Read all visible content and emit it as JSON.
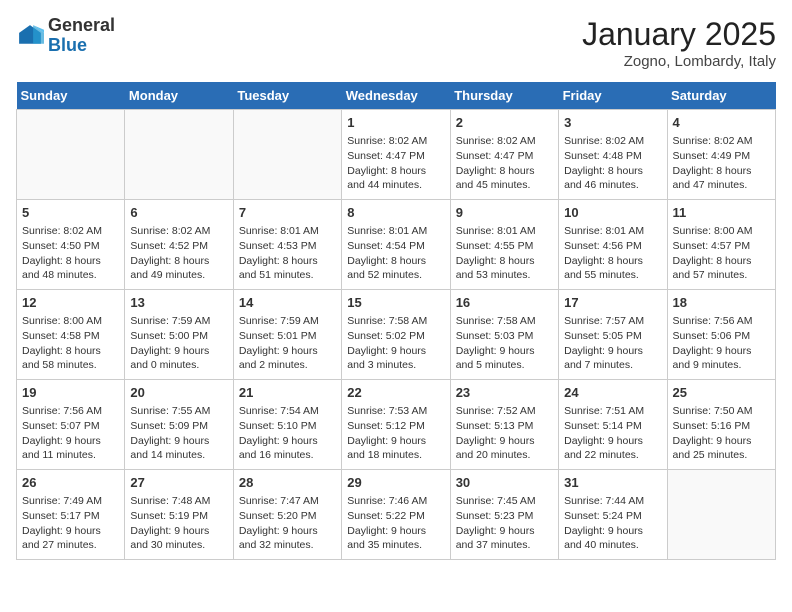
{
  "header": {
    "logo_general": "General",
    "logo_blue": "Blue",
    "month_title": "January 2025",
    "location": "Zogno, Lombardy, Italy"
  },
  "days_of_week": [
    "Sunday",
    "Monday",
    "Tuesday",
    "Wednesday",
    "Thursday",
    "Friday",
    "Saturday"
  ],
  "weeks": [
    [
      {
        "day": "",
        "empty": true
      },
      {
        "day": "",
        "empty": true
      },
      {
        "day": "",
        "empty": true
      },
      {
        "day": "1",
        "sunrise": "Sunrise: 8:02 AM",
        "sunset": "Sunset: 4:47 PM",
        "daylight": "Daylight: 8 hours and 44 minutes."
      },
      {
        "day": "2",
        "sunrise": "Sunrise: 8:02 AM",
        "sunset": "Sunset: 4:47 PM",
        "daylight": "Daylight: 8 hours and 45 minutes."
      },
      {
        "day": "3",
        "sunrise": "Sunrise: 8:02 AM",
        "sunset": "Sunset: 4:48 PM",
        "daylight": "Daylight: 8 hours and 46 minutes."
      },
      {
        "day": "4",
        "sunrise": "Sunrise: 8:02 AM",
        "sunset": "Sunset: 4:49 PM",
        "daylight": "Daylight: 8 hours and 47 minutes."
      }
    ],
    [
      {
        "day": "5",
        "sunrise": "Sunrise: 8:02 AM",
        "sunset": "Sunset: 4:50 PM",
        "daylight": "Daylight: 8 hours and 48 minutes."
      },
      {
        "day": "6",
        "sunrise": "Sunrise: 8:02 AM",
        "sunset": "Sunset: 4:52 PM",
        "daylight": "Daylight: 8 hours and 49 minutes."
      },
      {
        "day": "7",
        "sunrise": "Sunrise: 8:01 AM",
        "sunset": "Sunset: 4:53 PM",
        "daylight": "Daylight: 8 hours and 51 minutes."
      },
      {
        "day": "8",
        "sunrise": "Sunrise: 8:01 AM",
        "sunset": "Sunset: 4:54 PM",
        "daylight": "Daylight: 8 hours and 52 minutes."
      },
      {
        "day": "9",
        "sunrise": "Sunrise: 8:01 AM",
        "sunset": "Sunset: 4:55 PM",
        "daylight": "Daylight: 8 hours and 53 minutes."
      },
      {
        "day": "10",
        "sunrise": "Sunrise: 8:01 AM",
        "sunset": "Sunset: 4:56 PM",
        "daylight": "Daylight: 8 hours and 55 minutes."
      },
      {
        "day": "11",
        "sunrise": "Sunrise: 8:00 AM",
        "sunset": "Sunset: 4:57 PM",
        "daylight": "Daylight: 8 hours and 57 minutes."
      }
    ],
    [
      {
        "day": "12",
        "sunrise": "Sunrise: 8:00 AM",
        "sunset": "Sunset: 4:58 PM",
        "daylight": "Daylight: 8 hours and 58 minutes."
      },
      {
        "day": "13",
        "sunrise": "Sunrise: 7:59 AM",
        "sunset": "Sunset: 5:00 PM",
        "daylight": "Daylight: 9 hours and 0 minutes."
      },
      {
        "day": "14",
        "sunrise": "Sunrise: 7:59 AM",
        "sunset": "Sunset: 5:01 PM",
        "daylight": "Daylight: 9 hours and 2 minutes."
      },
      {
        "day": "15",
        "sunrise": "Sunrise: 7:58 AM",
        "sunset": "Sunset: 5:02 PM",
        "daylight": "Daylight: 9 hours and 3 minutes."
      },
      {
        "day": "16",
        "sunrise": "Sunrise: 7:58 AM",
        "sunset": "Sunset: 5:03 PM",
        "daylight": "Daylight: 9 hours and 5 minutes."
      },
      {
        "day": "17",
        "sunrise": "Sunrise: 7:57 AM",
        "sunset": "Sunset: 5:05 PM",
        "daylight": "Daylight: 9 hours and 7 minutes."
      },
      {
        "day": "18",
        "sunrise": "Sunrise: 7:56 AM",
        "sunset": "Sunset: 5:06 PM",
        "daylight": "Daylight: 9 hours and 9 minutes."
      }
    ],
    [
      {
        "day": "19",
        "sunrise": "Sunrise: 7:56 AM",
        "sunset": "Sunset: 5:07 PM",
        "daylight": "Daylight: 9 hours and 11 minutes."
      },
      {
        "day": "20",
        "sunrise": "Sunrise: 7:55 AM",
        "sunset": "Sunset: 5:09 PM",
        "daylight": "Daylight: 9 hours and 14 minutes."
      },
      {
        "day": "21",
        "sunrise": "Sunrise: 7:54 AM",
        "sunset": "Sunset: 5:10 PM",
        "daylight": "Daylight: 9 hours and 16 minutes."
      },
      {
        "day": "22",
        "sunrise": "Sunrise: 7:53 AM",
        "sunset": "Sunset: 5:12 PM",
        "daylight": "Daylight: 9 hours and 18 minutes."
      },
      {
        "day": "23",
        "sunrise": "Sunrise: 7:52 AM",
        "sunset": "Sunset: 5:13 PM",
        "daylight": "Daylight: 9 hours and 20 minutes."
      },
      {
        "day": "24",
        "sunrise": "Sunrise: 7:51 AM",
        "sunset": "Sunset: 5:14 PM",
        "daylight": "Daylight: 9 hours and 22 minutes."
      },
      {
        "day": "25",
        "sunrise": "Sunrise: 7:50 AM",
        "sunset": "Sunset: 5:16 PM",
        "daylight": "Daylight: 9 hours and 25 minutes."
      }
    ],
    [
      {
        "day": "26",
        "sunrise": "Sunrise: 7:49 AM",
        "sunset": "Sunset: 5:17 PM",
        "daylight": "Daylight: 9 hours and 27 minutes."
      },
      {
        "day": "27",
        "sunrise": "Sunrise: 7:48 AM",
        "sunset": "Sunset: 5:19 PM",
        "daylight": "Daylight: 9 hours and 30 minutes."
      },
      {
        "day": "28",
        "sunrise": "Sunrise: 7:47 AM",
        "sunset": "Sunset: 5:20 PM",
        "daylight": "Daylight: 9 hours and 32 minutes."
      },
      {
        "day": "29",
        "sunrise": "Sunrise: 7:46 AM",
        "sunset": "Sunset: 5:22 PM",
        "daylight": "Daylight: 9 hours and 35 minutes."
      },
      {
        "day": "30",
        "sunrise": "Sunrise: 7:45 AM",
        "sunset": "Sunset: 5:23 PM",
        "daylight": "Daylight: 9 hours and 37 minutes."
      },
      {
        "day": "31",
        "sunrise": "Sunrise: 7:44 AM",
        "sunset": "Sunset: 5:24 PM",
        "daylight": "Daylight: 9 hours and 40 minutes."
      },
      {
        "day": "",
        "empty": true
      }
    ]
  ]
}
